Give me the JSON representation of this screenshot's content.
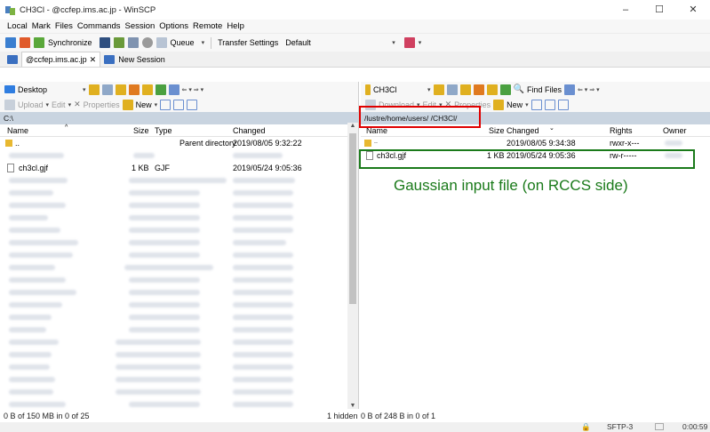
{
  "window": {
    "title": "CH3Cl - @ccfep.ims.ac.jp - WinSCP",
    "controls": [
      "–",
      "☐",
      "✕"
    ]
  },
  "menu": [
    "Local",
    "Mark",
    "Files",
    "Commands",
    "Session",
    "Options",
    "Remote",
    "Help"
  ],
  "toolbar": {
    "synchronize": "Synchronize",
    "queue": "Queue",
    "transfer_settings": "Transfer Settings",
    "transfer_value": "Default"
  },
  "session_tabs": {
    "current": "@ccfep.ims.ac.jp",
    "close": "✕",
    "new_session": "New Session"
  },
  "left_pane": {
    "location": "Desktop",
    "find_files": "",
    "buttons": {
      "upload": "Upload",
      "edit": "Edit",
      "properties": "Properties",
      "new": "New"
    },
    "path": "C:\\",
    "columns": {
      "name": "Name",
      "size": "Size",
      "type": "Type",
      "changed": "Changed"
    },
    "rows": [
      {
        "name": "..",
        "size": "",
        "type": "Parent directory",
        "changed": "2019/08/05  9:32:22"
      },
      {
        "name": "ch3cl.gjf",
        "size": "1 KB",
        "type": "GJF",
        "changed": "2019/05/24  9:05:36"
      }
    ],
    "status": "0 B of 150 MB in 0 of 25"
  },
  "right_pane": {
    "location": "CH3Cl",
    "find_files": "Find Files",
    "buttons": {
      "download": "Download",
      "edit": "Edit",
      "properties": "Properties",
      "new": "New"
    },
    "path": "/lustre/home/users/     /CH3Cl/",
    "columns": {
      "name": "Name",
      "size": "Size",
      "changed": "Changed",
      "rights": "Rights",
      "owner": "Owner"
    },
    "rows": [
      {
        "name": "..",
        "size": "",
        "changed": "2019/08/05  9:34:38",
        "rights": "rwxr-x---",
        "owner": ""
      },
      {
        "name": "ch3cl.gjf",
        "size": "1 KB",
        "changed": "2019/05/24  9:05:36",
        "rights": "rw-r-----",
        "owner": ""
      }
    ],
    "hidden": "1 hidden",
    "status": "0 B of 248 B in 0 of 1"
  },
  "bottom_status": {
    "protocol": "SFTP-3",
    "time": "0:00:59"
  },
  "annotation": {
    "text": "Gaussian input file (on RCCS side)",
    "color": "#1a7a1a"
  }
}
